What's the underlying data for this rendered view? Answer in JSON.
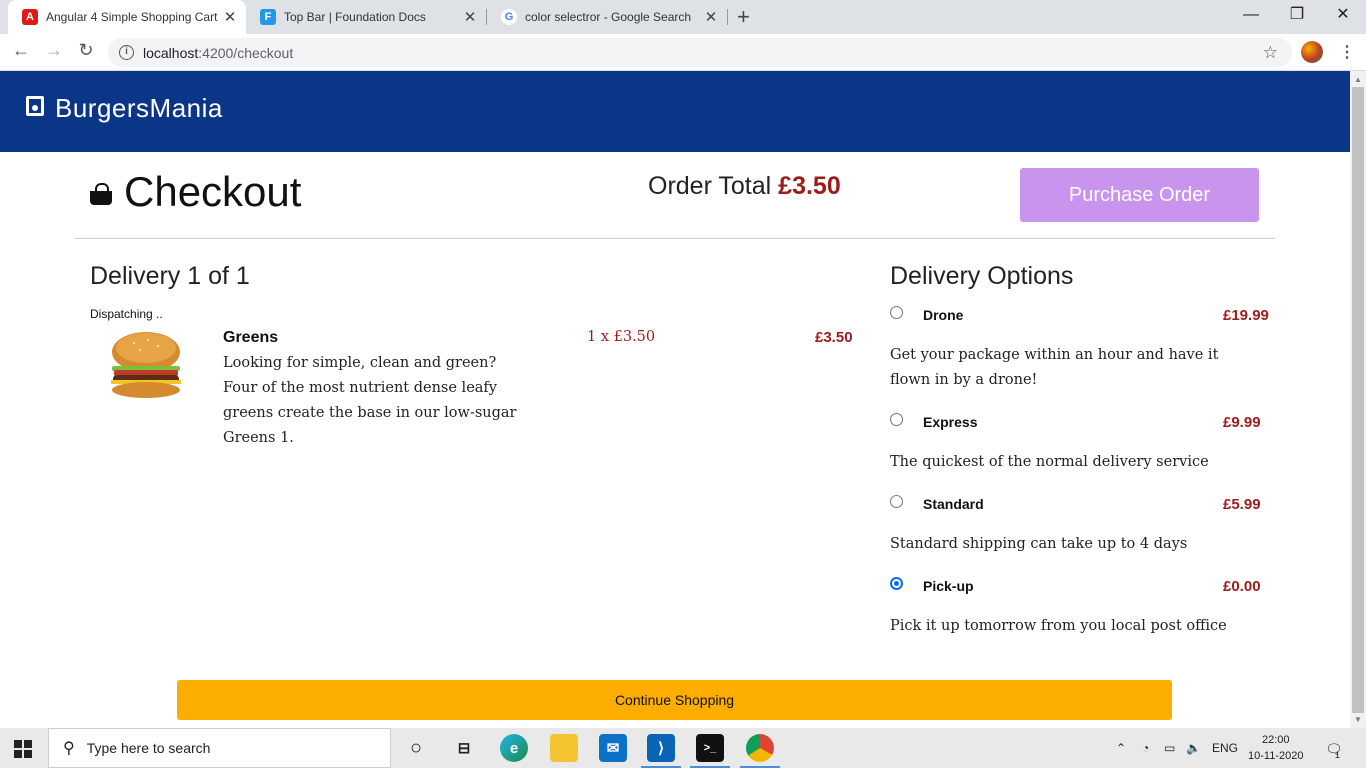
{
  "browser": {
    "tabs": [
      {
        "title": "Angular 4 Simple Shopping Cart",
        "favicon": "A"
      },
      {
        "title": "Top Bar | Foundation Docs",
        "favicon": "F"
      },
      {
        "title": "color selectror - Google Search",
        "favicon": "G"
      }
    ],
    "url_host": "localhost",
    "url_path": ":4200/checkout"
  },
  "site": {
    "brand": "BurgersMania"
  },
  "checkout": {
    "title": "Checkout",
    "order_total_label": "Order Total",
    "order_total_amount": "£3.50",
    "purchase_label": "Purchase Order"
  },
  "delivery": {
    "title": "Delivery 1 of 1",
    "status": "Dispatching ..",
    "item": {
      "name": "Greens",
      "description": "Looking for simple, clean and green? Four of the most nutrient dense leafy greens create the base in our low-sugar Greens 1.",
      "quantity_price": "1 x £3.50",
      "total": "£3.50"
    }
  },
  "options": {
    "title": "Delivery Options",
    "items": [
      {
        "name": "Drone",
        "price": "£19.99",
        "description": "Get your package within an hour and have it flown in by a drone!",
        "selected": false
      },
      {
        "name": "Express",
        "price": "£9.99",
        "description": "The quickest of the normal delivery service",
        "selected": false
      },
      {
        "name": "Standard",
        "price": "£5.99",
        "description": "Standard shipping can take up to 4 days",
        "selected": false
      },
      {
        "name": "Pick-up",
        "price": "£0.00",
        "description": "Pick it up tomorrow from you local post office",
        "selected": true
      }
    ]
  },
  "continue_label": "Continue Shopping",
  "taskbar": {
    "search_placeholder": "Type here to search",
    "language": "ENG",
    "time": "22:00",
    "date": "10-11-2020",
    "notification_count": "1"
  },
  "colors": {
    "header": "#0b3586",
    "price": "#9b1c1c",
    "purchase_button": "#c894ee",
    "continue_button": "#fdac00"
  }
}
